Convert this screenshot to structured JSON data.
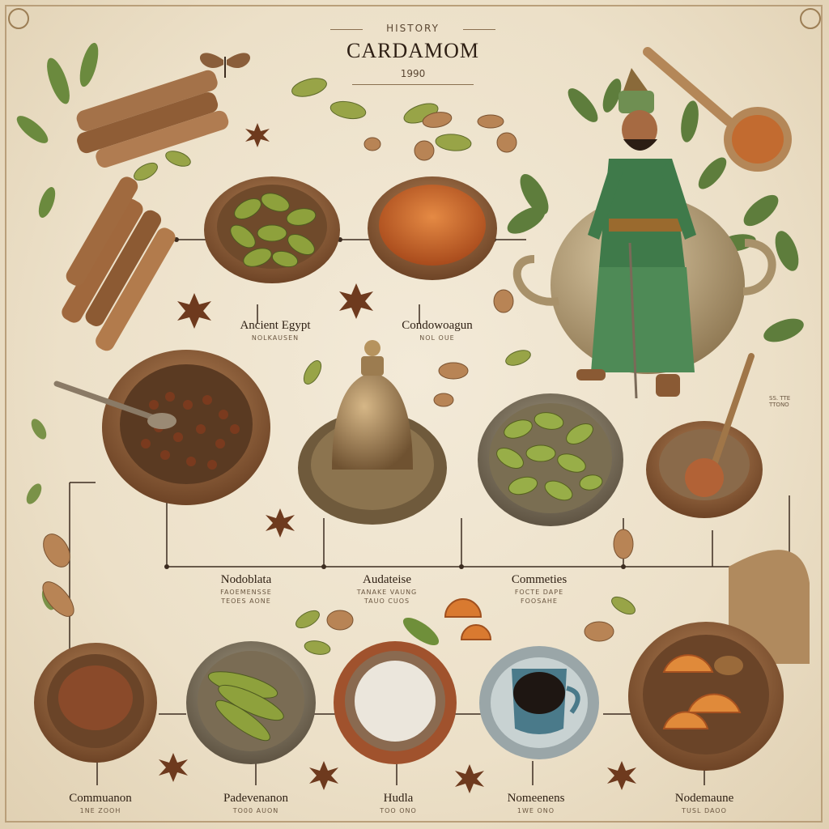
{
  "header": {
    "kicker": "HISTORY",
    "title": "CARDAMOM",
    "year": "1990"
  },
  "top_labels": [
    {
      "title": "Ancient Egypt",
      "sub": "NOLKAUSEN"
    },
    {
      "title": "Condowoagun",
      "sub": "NOL OUE"
    }
  ],
  "middle_labels": [
    {
      "title": "Nodoblata",
      "sub1": "FAOEMENSSE",
      "sub2": "TEOES AONE"
    },
    {
      "title": "Audateise",
      "sub1": "TANAKE VAUNG",
      "sub2": "TAUO CUOS"
    },
    {
      "title": "Commeties",
      "sub1": "FOCTE DAPE",
      "sub2": "FOOSAHE"
    }
  ],
  "bottom_labels": [
    {
      "title": "Commuanon",
      "sub": "1NE ZOOH"
    },
    {
      "title": "Padevenanon",
      "sub": "TO00 AUON"
    },
    {
      "title": "Hudla",
      "sub": "TOO ONO"
    },
    {
      "title": "Nomeenens",
      "sub": "1WE ONO"
    },
    {
      "title": "Nodemaune",
      "sub": "TUSL DAOO"
    }
  ],
  "side_note": {
    "line1": "SS. TTE",
    "line2": "TTONO"
  },
  "colors": {
    "parchment": "#efe4ce",
    "wood": "#8a5a34",
    "pod_green": "#8a9a3a",
    "spice_orange": "#c8642a",
    "leaf_green": "#5c7a3a",
    "line": "#3c2c20"
  }
}
